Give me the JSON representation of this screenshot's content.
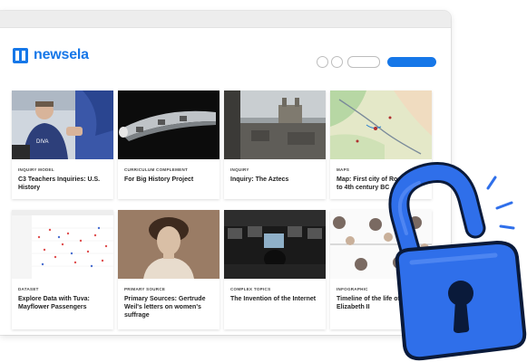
{
  "brand": {
    "name": "newsela",
    "accent": "#1677e8"
  },
  "cards": [
    {
      "type": "INQUIRY MODEL",
      "title": "C3 Teachers Inquiries: U.S. History",
      "image": "teachers-photo"
    },
    {
      "type": "CURRICULUM COMPLEMENT",
      "title": "For Big History Project",
      "image": "hyperloop-photo"
    },
    {
      "type": "INQUIRY",
      "title": "Inquiry: The Aztecs",
      "image": "aztec-city-photo"
    },
    {
      "type": "MAPS",
      "title": "Map: First city of Rome, 7th to 4th century BC",
      "image": "rome-map"
    },
    {
      "type": "DATASET",
      "title": "Explore Data with Tuva: Mayflower Passengers",
      "image": "scatter-plot"
    },
    {
      "type": "PRIMARY SOURCE",
      "title": "Primary Sources: Gertrude Weil's letters on women's suffrage",
      "image": "portrait-photo"
    },
    {
      "type": "COMPLEX TOPICS",
      "title": "The Invention of the Internet",
      "image": "computer-lab-photo"
    },
    {
      "type": "INFOGRAPHIC",
      "title": "Timeline of the life of Queen Elizabeth II",
      "image": "timeline-infographic"
    }
  ],
  "overlay": {
    "icon": "unlocked-padlock-icon",
    "color": "#2f6fea"
  }
}
